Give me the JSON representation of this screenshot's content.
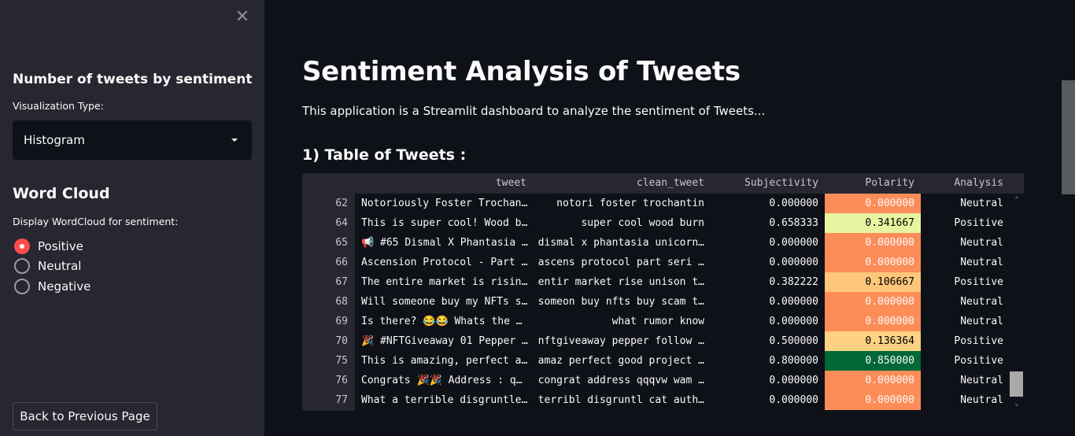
{
  "sidebar": {
    "close_icon": "close-icon",
    "viz_heading": "Number of tweets by sentiment",
    "viz_label": "Visualization Type:",
    "viz_select": {
      "value": "Histogram",
      "caret_icon": "caret-down-icon"
    },
    "wordcloud_heading": "Word Cloud",
    "wordcloud_label": "Display WordCloud for sentiment:",
    "radio_options": [
      {
        "label": "Positive",
        "checked": true
      },
      {
        "label": "Neutral",
        "checked": false
      },
      {
        "label": "Negative",
        "checked": false
      }
    ],
    "back_button": "Back to Previous Page"
  },
  "main": {
    "title": "Sentiment Analysis of Tweets",
    "intro": "This application is a Streamlit dashboard to analyze the sentiment of Tweets...",
    "section_title": "1) Table of Tweets :"
  },
  "table": {
    "columns": [
      "tweet",
      "clean_tweet",
      "Subjectivity",
      "Polarity",
      "Analysis"
    ],
    "rows": [
      {
        "idx": "62",
        "tweet": "Notoriously Foster Trochan…",
        "clean_tweet": "notori foster trochantin",
        "subjectivity": "0.000000",
        "polarity": "0.000000",
        "analysis": "Neutral",
        "pol_color": "#fc8d59",
        "pol_text": "#fafafa"
      },
      {
        "idx": "64",
        "tweet": "This is super cool! Wood b…",
        "clean_tweet": "super cool wood burn",
        "subjectivity": "0.658333",
        "polarity": "0.341667",
        "analysis": "Positive",
        "pol_color": "#e7f5a1",
        "pol_text": "#000000"
      },
      {
        "idx": "65",
        "tweet": "📢 #65 Dismal X Phantasia …",
        "clean_tweet": "dismal x phantasia unicorn…",
        "subjectivity": "0.000000",
        "polarity": "0.000000",
        "analysis": "Neutral",
        "pol_color": "#fc8d59",
        "pol_text": "#fafafa"
      },
      {
        "idx": "66",
        "tweet": "Ascension Protocol - Part …",
        "clean_tweet": "ascens protocol part seri …",
        "subjectivity": "0.000000",
        "polarity": "0.000000",
        "analysis": "Neutral",
        "pol_color": "#fc8d59",
        "pol_text": "#fafafa"
      },
      {
        "idx": "67",
        "tweet": "The entire market is risin…",
        "clean_tweet": "entir market rise unison t…",
        "subjectivity": "0.382222",
        "polarity": "0.106667",
        "analysis": "Positive",
        "pol_color": "#fec67a",
        "pol_text": "#000000"
      },
      {
        "idx": "68",
        "tweet": "Will someone buy my NFTs s…",
        "clean_tweet": "someon buy nfts buy scam t…",
        "subjectivity": "0.000000",
        "polarity": "0.000000",
        "analysis": "Neutral",
        "pol_color": "#fc8d59",
        "pol_text": "#fafafa"
      },
      {
        "idx": "69",
        "tweet": "Is there? 😂😂 Whats the …",
        "clean_tweet": "what rumor know",
        "subjectivity": "0.000000",
        "polarity": "0.000000",
        "analysis": "Neutral",
        "pol_color": "#fc8d59",
        "pol_text": "#fafafa"
      },
      {
        "idx": "70",
        "tweet": "🎉 #NFTGiveaway 01 Pepper …",
        "clean_tweet": "nftgiveaway pepper follow …",
        "subjectivity": "0.500000",
        "polarity": "0.136364",
        "analysis": "Positive",
        "pol_color": "#fed283",
        "pol_text": "#000000"
      },
      {
        "idx": "75",
        "tweet": "This is amazing, perfect a…",
        "clean_tweet": "amaz perfect good project …",
        "subjectivity": "0.800000",
        "polarity": "0.850000",
        "analysis": "Positive",
        "pol_color": "#006837",
        "pol_text": "#fafafa"
      },
      {
        "idx": "76",
        "tweet": "Congrats 🎉🎉 Address : q…",
        "clean_tweet": "congrat address qqqvw wam …",
        "subjectivity": "0.000000",
        "polarity": "0.000000",
        "analysis": "Neutral",
        "pol_color": "#fc8d59",
        "pol_text": "#fafafa"
      },
      {
        "idx": "77",
        "tweet": "What a terrible disgruntle…",
        "clean_tweet": "terribl disgruntl cat auth…",
        "subjectivity": "0.000000",
        "polarity": "0.000000",
        "analysis": "Neutral",
        "pol_color": "#fc8d59",
        "pol_text": "#fafafa"
      }
    ]
  },
  "colors": {
    "accent": "#ff4b4b",
    "sidebar_bg": "#262730",
    "main_bg": "#0e1117"
  }
}
